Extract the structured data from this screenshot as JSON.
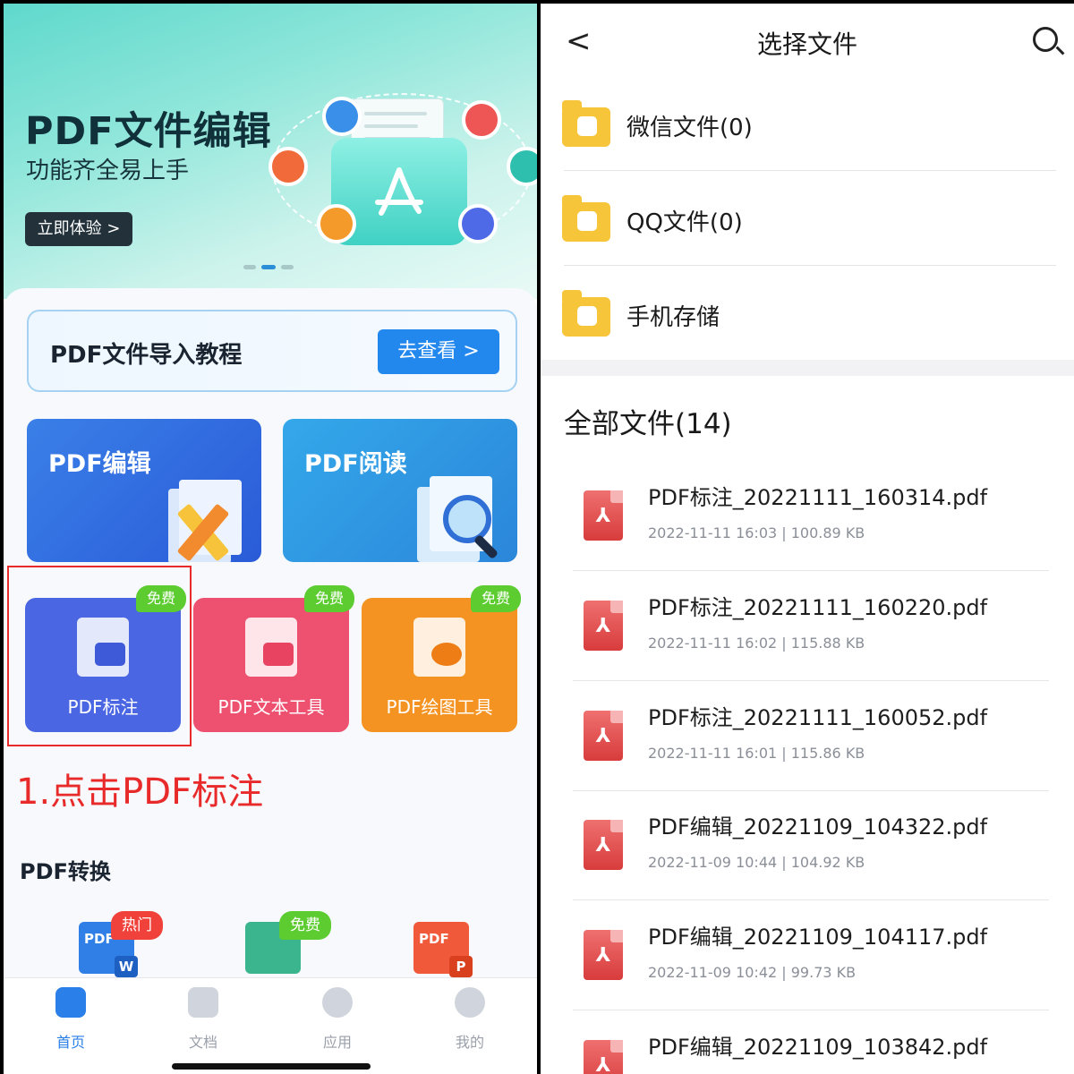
{
  "left": {
    "banner": {
      "title": "PDF文件编辑",
      "subtitle": "功能齐全易上手",
      "cta": "立即体验 >"
    },
    "tutorial": {
      "label": "PDF文件导入教程",
      "button": "去查看 >"
    },
    "big_tools": [
      {
        "label": "PDF编辑",
        "icon": "pencil-ruler-icon"
      },
      {
        "label": "PDF阅读",
        "icon": "magnifier-icon"
      }
    ],
    "small_tools": [
      {
        "label": "PDF标注",
        "badge": "免费",
        "icon": "annotate-icon",
        "color": "#4a66e2"
      },
      {
        "label": "PDF文本工具",
        "badge": "免费",
        "icon": "text-tool-icon",
        "color": "#ee5070"
      },
      {
        "label": "PDF绘图工具",
        "badge": "免费",
        "icon": "palette-icon",
        "color": "#f59322"
      }
    ],
    "annotation_tip": "1.点击PDF标注",
    "conversion": {
      "title": "PDF转换",
      "items": [
        {
          "badge": "热门",
          "top": "PDF",
          "bottom": "W",
          "icon": "pdf-to-word-icon"
        },
        {
          "badge": "免费",
          "top": "",
          "bottom": "",
          "icon": "image-to-pdf-icon"
        },
        {
          "badge": "",
          "top": "PDF",
          "bottom": "P",
          "icon": "pdf-to-ppt-icon"
        }
      ]
    },
    "tabs": [
      {
        "label": "首页",
        "icon": "home-icon",
        "active": true
      },
      {
        "label": "文档",
        "icon": "document-icon",
        "active": false
      },
      {
        "label": "应用",
        "icon": "apps-icon",
        "active": false
      },
      {
        "label": "我的",
        "icon": "profile-icon",
        "active": false
      }
    ]
  },
  "right": {
    "nav": {
      "title": "选择文件",
      "back": "<"
    },
    "folders": [
      {
        "label": "微信文件(0)",
        "icon": "wechat-folder-icon"
      },
      {
        "label": "QQ文件(0)",
        "icon": "qq-folder-icon"
      },
      {
        "label": "手机存储",
        "icon": "phone-storage-folder-icon"
      }
    ],
    "all_files_title": "全部文件(14)",
    "files": [
      {
        "name": "PDF标注_20221111_160314.pdf",
        "meta": "2022-11-11 16:03 |   100.89 KB"
      },
      {
        "name": "PDF标注_20221111_160220.pdf",
        "meta": "2022-11-11 16:02 |   115.88 KB"
      },
      {
        "name": "PDF标注_20221111_160052.pdf",
        "meta": "2022-11-11 16:01 |   115.86 KB"
      },
      {
        "name": "PDF编辑_20221109_104322.pdf",
        "meta": "2022-11-09 10:44 |   104.92 KB"
      },
      {
        "name": "PDF编辑_20221109_104117.pdf",
        "meta": "2022-11-09 10:42 |   99.73 KB"
      },
      {
        "name": "PDF编辑_20221109_103842.pdf",
        "meta": ""
      }
    ]
  }
}
